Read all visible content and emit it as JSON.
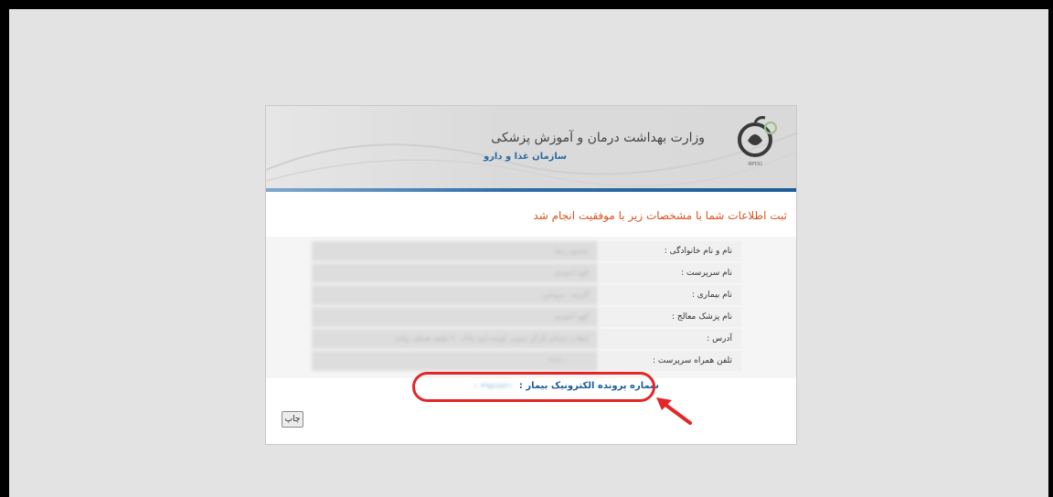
{
  "header": {
    "ministry_title": "وزارت بهداشت درمان و آموزش پزشکی",
    "org_subtitle": "سازمان غذا و دارو",
    "logo_caption": "IRFDO"
  },
  "success_message": "ثبت اطلاعات شما با مشخصات زیر با موفقیت انجام شد",
  "info_rows": [
    {
      "label": "نام و نام خانوادگی :",
      "value": "محمود رضا"
    },
    {
      "label": "نام سرپرست :",
      "value": "الهه احمدی"
    },
    {
      "label": "نام بیماری :",
      "value": "آلرژی - پروتئین"
    },
    {
      "label": "نام پزشک معالج :",
      "value": "الهه احمدی"
    },
    {
      "label": "آدرس :",
      "value": "انقلاب خیابان کارگر جنوبی کوچه امید پلاک ۲۰ طبقه همکف واحد"
    },
    {
      "label": "تلفن همراه سرپرست :",
      "value": "۰۹۱۲۰۰۰۰۰۰۰"
    }
  ],
  "record": {
    "label": "شماره پرونده الکترونیک بیمار :",
    "value": "۱۰۴۹۵۶۸۷۲۱"
  },
  "print_button": "چاپ",
  "colors": {
    "success": "#d9531e",
    "accent_blue": "#1d5d96",
    "annotation_red": "#e32626"
  }
}
